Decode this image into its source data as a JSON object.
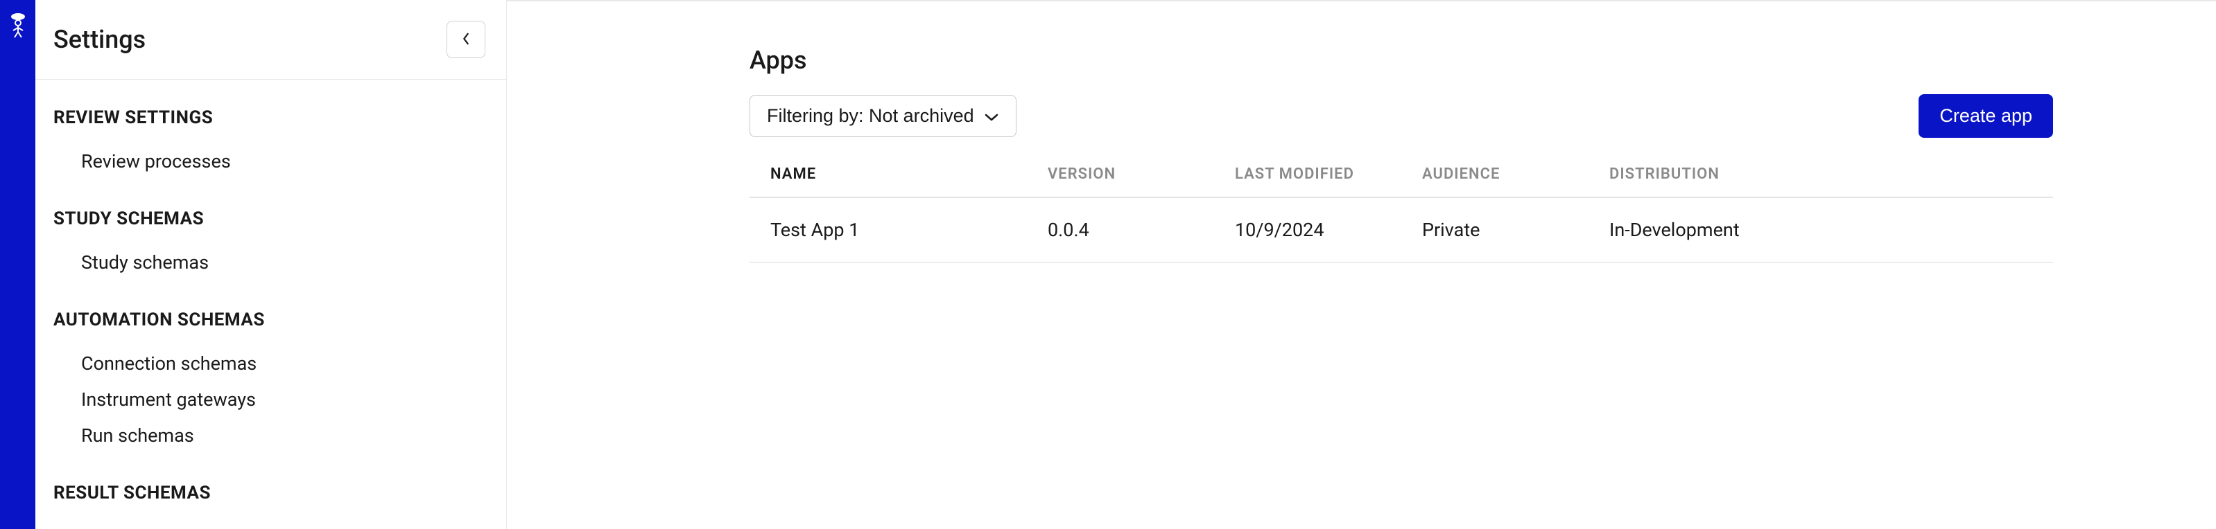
{
  "sidebar": {
    "title": "Settings",
    "sections": [
      {
        "title": "REVIEW SETTINGS",
        "items": [
          "Review processes"
        ]
      },
      {
        "title": "STUDY SCHEMAS",
        "items": [
          "Study schemas"
        ]
      },
      {
        "title": "AUTOMATION SCHEMAS",
        "items": [
          "Connection schemas",
          "Instrument gateways",
          "Run schemas"
        ]
      },
      {
        "title": "RESULT SCHEMAS",
        "items": []
      }
    ]
  },
  "main": {
    "page_title": "Apps",
    "filter_label": "Filtering by: Not archived",
    "create_label": "Create app",
    "columns": [
      "NAME",
      "VERSION",
      "LAST MODIFIED",
      "AUDIENCE",
      "DISTRIBUTION"
    ],
    "rows": [
      {
        "name": "Test App 1",
        "version": "0.0.4",
        "last_modified": "10/9/2024",
        "audience": "Private",
        "distribution": "In-Development"
      }
    ]
  }
}
